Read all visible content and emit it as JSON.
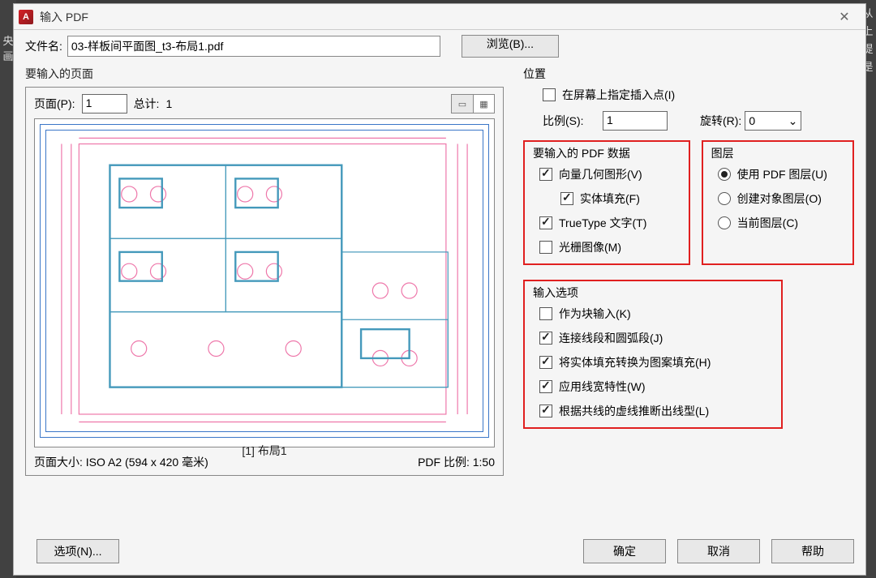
{
  "bgRight": "从\n上\n提\n是",
  "bgLeft": "央\n画",
  "titlebar": {
    "appIcon": "A",
    "title": "输入 PDF",
    "close": "✕"
  },
  "fileRow": {
    "label": "文件名:",
    "value": "03-样板间平面图_t3-布局1.pdf",
    "browse": "浏览(B)..."
  },
  "preview": {
    "legend": "要输入的页面",
    "pageLabel": "页面(P):",
    "pageValue": "1",
    "totalLabel": "总计:",
    "totalValue": "1",
    "caption": "[1] 布局1",
    "pageSize": "页面大小: ISO A2 (594 x 420 毫米)",
    "pdfScale": "PDF 比例: 1:50"
  },
  "position": {
    "legend": "位置",
    "specifyOnScreen": "在屏幕上指定插入点(I)",
    "scaleLabel": "比例(S):",
    "scaleValue": "1",
    "rotLabel": "旋转(R):",
    "rotValue": "0"
  },
  "pdfData": {
    "legend": "要输入的 PDF 数据",
    "vector": "向量几何图形(V)",
    "solid": "实体填充(F)",
    "ttype": "TrueType 文字(T)",
    "raster": "光栅图像(M)"
  },
  "layers": {
    "legend": "图层",
    "usePdf": "使用 PDF 图层(U)",
    "createObj": "创建对象图层(O)",
    "current": "当前图层(C)"
  },
  "importOpts": {
    "legend": "输入选项",
    "asBlock": "作为块输入(K)",
    "joinArcs": "连接线段和圆弧段(J)",
    "solidToHatch": "将实体填充转换为图案填充(H)",
    "lineweights": "应用线宽特性(W)",
    "inferLT": "根据共线的虚线推断出线型(L)"
  },
  "footer": {
    "options": "选项(N)...",
    "ok": "确定",
    "cancel": "取消",
    "help": "帮助"
  }
}
